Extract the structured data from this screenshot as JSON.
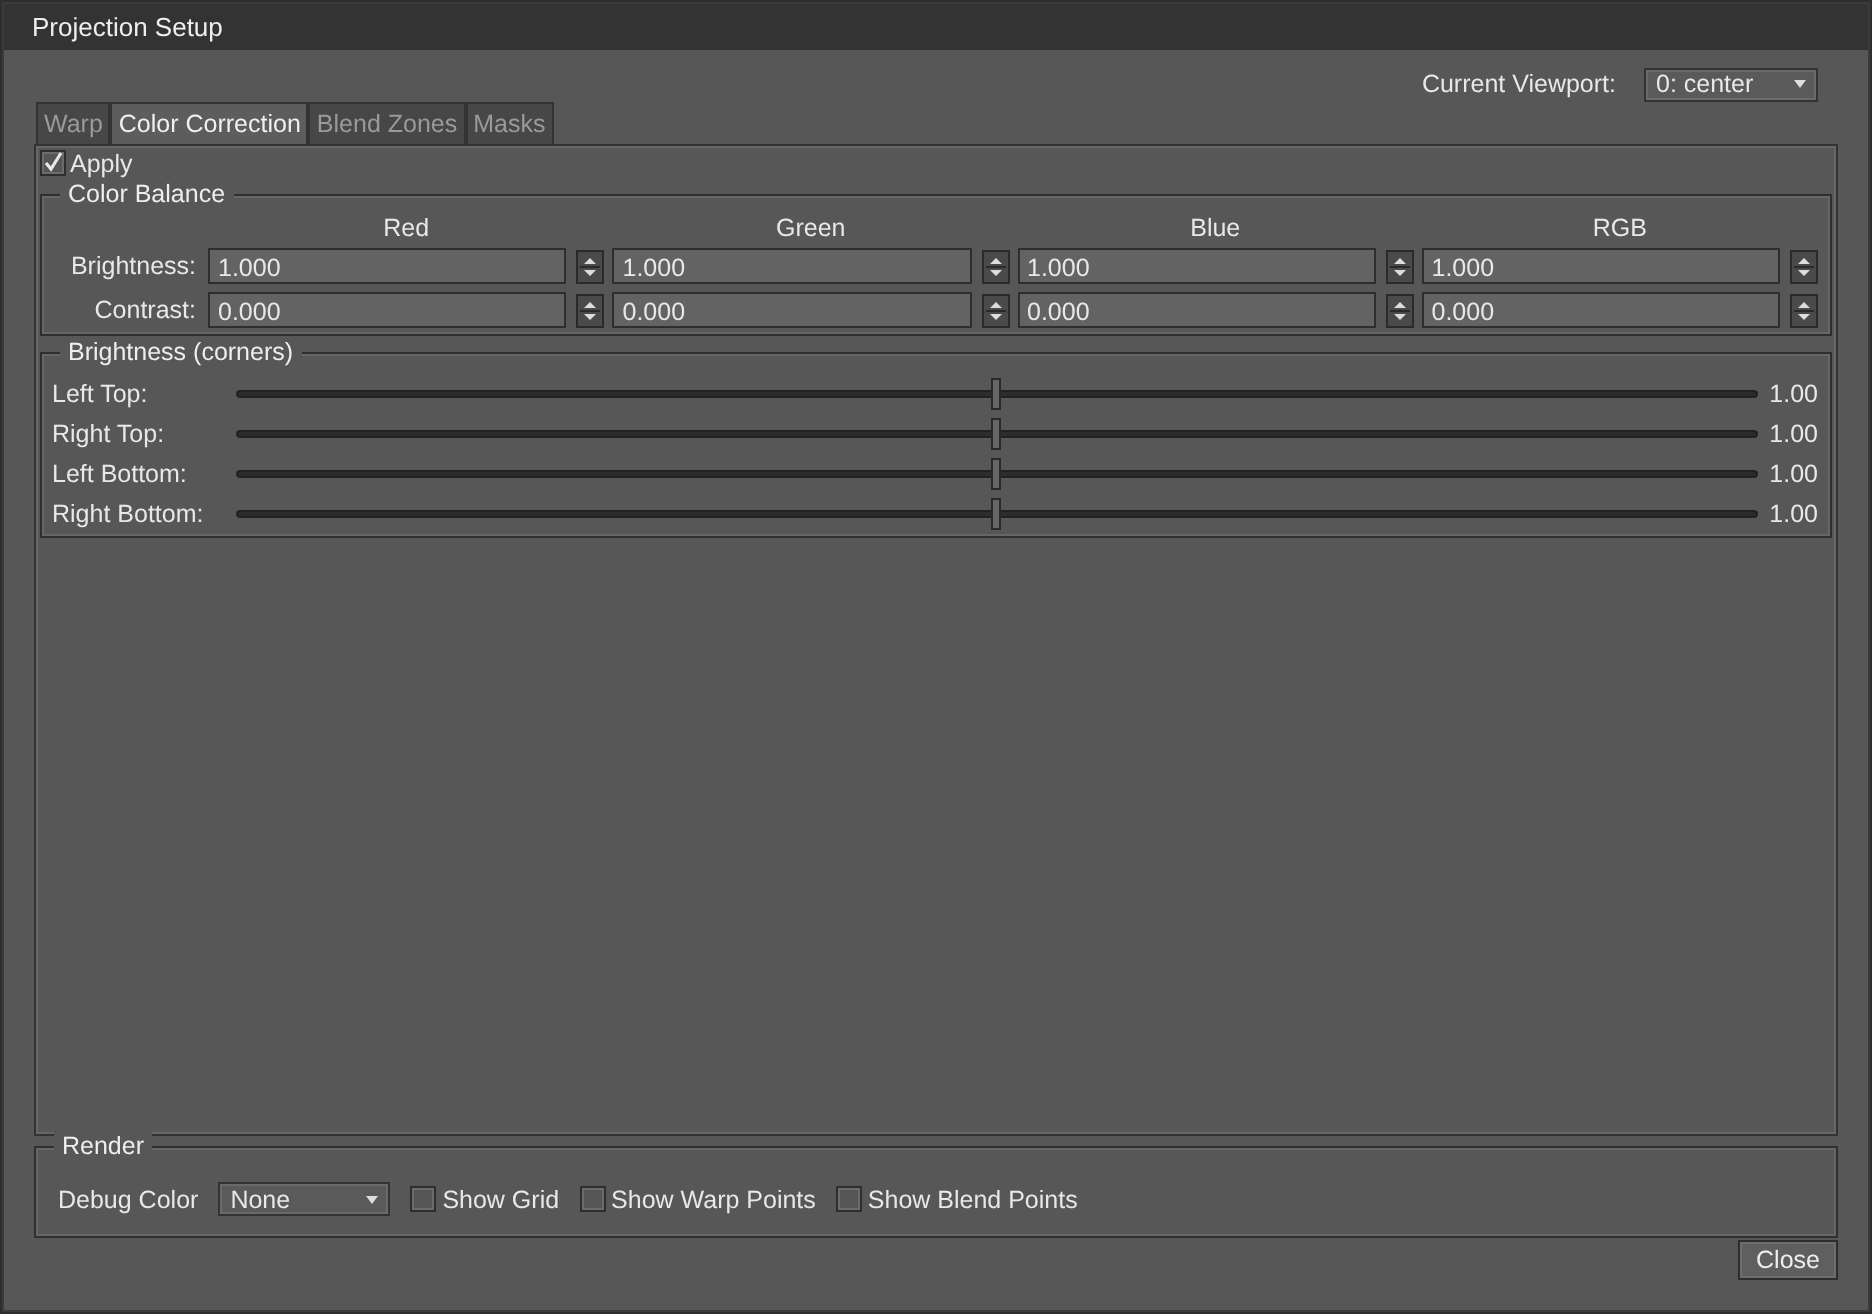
{
  "window": {
    "title": "Projection Setup"
  },
  "viewport": {
    "label": "Current Viewport:",
    "value": "0: center"
  },
  "tabs": [
    {
      "label": "Warp",
      "selected": false
    },
    {
      "label": "Color Correction",
      "selected": true
    },
    {
      "label": "Blend Zones",
      "selected": false
    },
    {
      "label": "Masks",
      "selected": false
    }
  ],
  "apply": {
    "label": "Apply",
    "checked": true
  },
  "color_balance": {
    "title": "Color Balance",
    "columns": [
      "Red",
      "Green",
      "Blue",
      "RGB"
    ],
    "rows": [
      {
        "label": "Brightness:",
        "values": [
          "1.000",
          "1.000",
          "1.000",
          "1.000"
        ]
      },
      {
        "label": "Contrast:",
        "values": [
          "0.000",
          "0.000",
          "0.000",
          "0.000"
        ]
      }
    ]
  },
  "corners": {
    "title": "Brightness (corners)",
    "sliders": [
      {
        "label": "Left Top:",
        "level": 0.5,
        "reading": "1.00"
      },
      {
        "label": "Right Top:",
        "level": 0.5,
        "reading": "1.00"
      },
      {
        "label": "Left Bottom:",
        "level": 0.5,
        "reading": "1.00"
      },
      {
        "label": "Right Bottom:",
        "level": 0.5,
        "reading": "1.00"
      }
    ]
  },
  "render": {
    "title": "Render",
    "debug_label": "Debug Color",
    "debug_value": "None",
    "options": [
      {
        "label": "Show Grid",
        "checked": false
      },
      {
        "label": "Show Warp Points",
        "checked": false
      },
      {
        "label": "Show Blend Points",
        "checked": false
      }
    ]
  },
  "buttons": [
    "Close"
  ]
}
